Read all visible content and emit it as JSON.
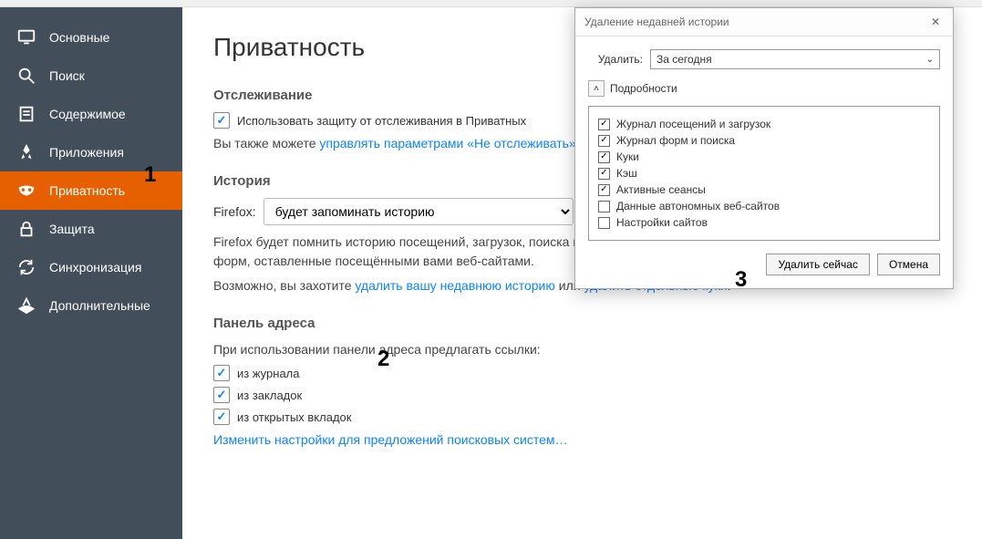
{
  "sidebar": {
    "items": [
      {
        "label": "Основные"
      },
      {
        "label": "Поиск"
      },
      {
        "label": "Содержимое"
      },
      {
        "label": "Приложения"
      },
      {
        "label": "Приватность"
      },
      {
        "label": "Защита"
      },
      {
        "label": "Синхронизация"
      },
      {
        "label": "Дополнительные"
      }
    ]
  },
  "main": {
    "title": "Приватность",
    "tracking_h": "Отслеживание",
    "tracking_cb": "Использовать защиту от отслеживания в Приватных",
    "tracking_txt": "Вы также можете ",
    "tracking_link": "управлять параметрами «Не отслеживать»",
    "history_h": "История",
    "ff_label": "Firefox:",
    "ff_select": "будет запоминать историю",
    "history_desc": "Firefox будет помнить историю посещений, загрузок, поиска и сохранит куки, а также данные форм, оставленные посещёнными вами веб-сайтами.",
    "maybe_txt": "Возможно, вы захотите ",
    "maybe_link1": "удалить вашу недавнюю историю",
    "maybe_or": " или ",
    "maybe_link2": "удалить отдельные куки",
    "addr_h": "Панель адреса",
    "addr_txt": "При использовании панели адреса предлагать ссылки:",
    "addr_cb1": "из журнала",
    "addr_cb2": "из закладок",
    "addr_cb3": "из открытых вкладок",
    "addr_link": "Изменить настройки для предложений поисковых систем…"
  },
  "dialog": {
    "title": "Удаление недавней истории",
    "del_label": "Удалить:",
    "del_value": "За сегодня",
    "details_label": "Подробности",
    "items": [
      {
        "label": "Журнал посещений и загрузок",
        "checked": true
      },
      {
        "label": "Журнал форм и поиска",
        "checked": true
      },
      {
        "label": "Куки",
        "checked": true
      },
      {
        "label": "Кэш",
        "checked": true
      },
      {
        "label": "Активные сеансы",
        "checked": true
      },
      {
        "label": "Данные автономных веб-сайтов",
        "checked": false
      },
      {
        "label": "Настройки сайтов",
        "checked": false
      }
    ],
    "ok": "Удалить сейчас",
    "cancel": "Отмена"
  },
  "annotations": {
    "a1": "1",
    "a2": "2",
    "a3": "3"
  }
}
